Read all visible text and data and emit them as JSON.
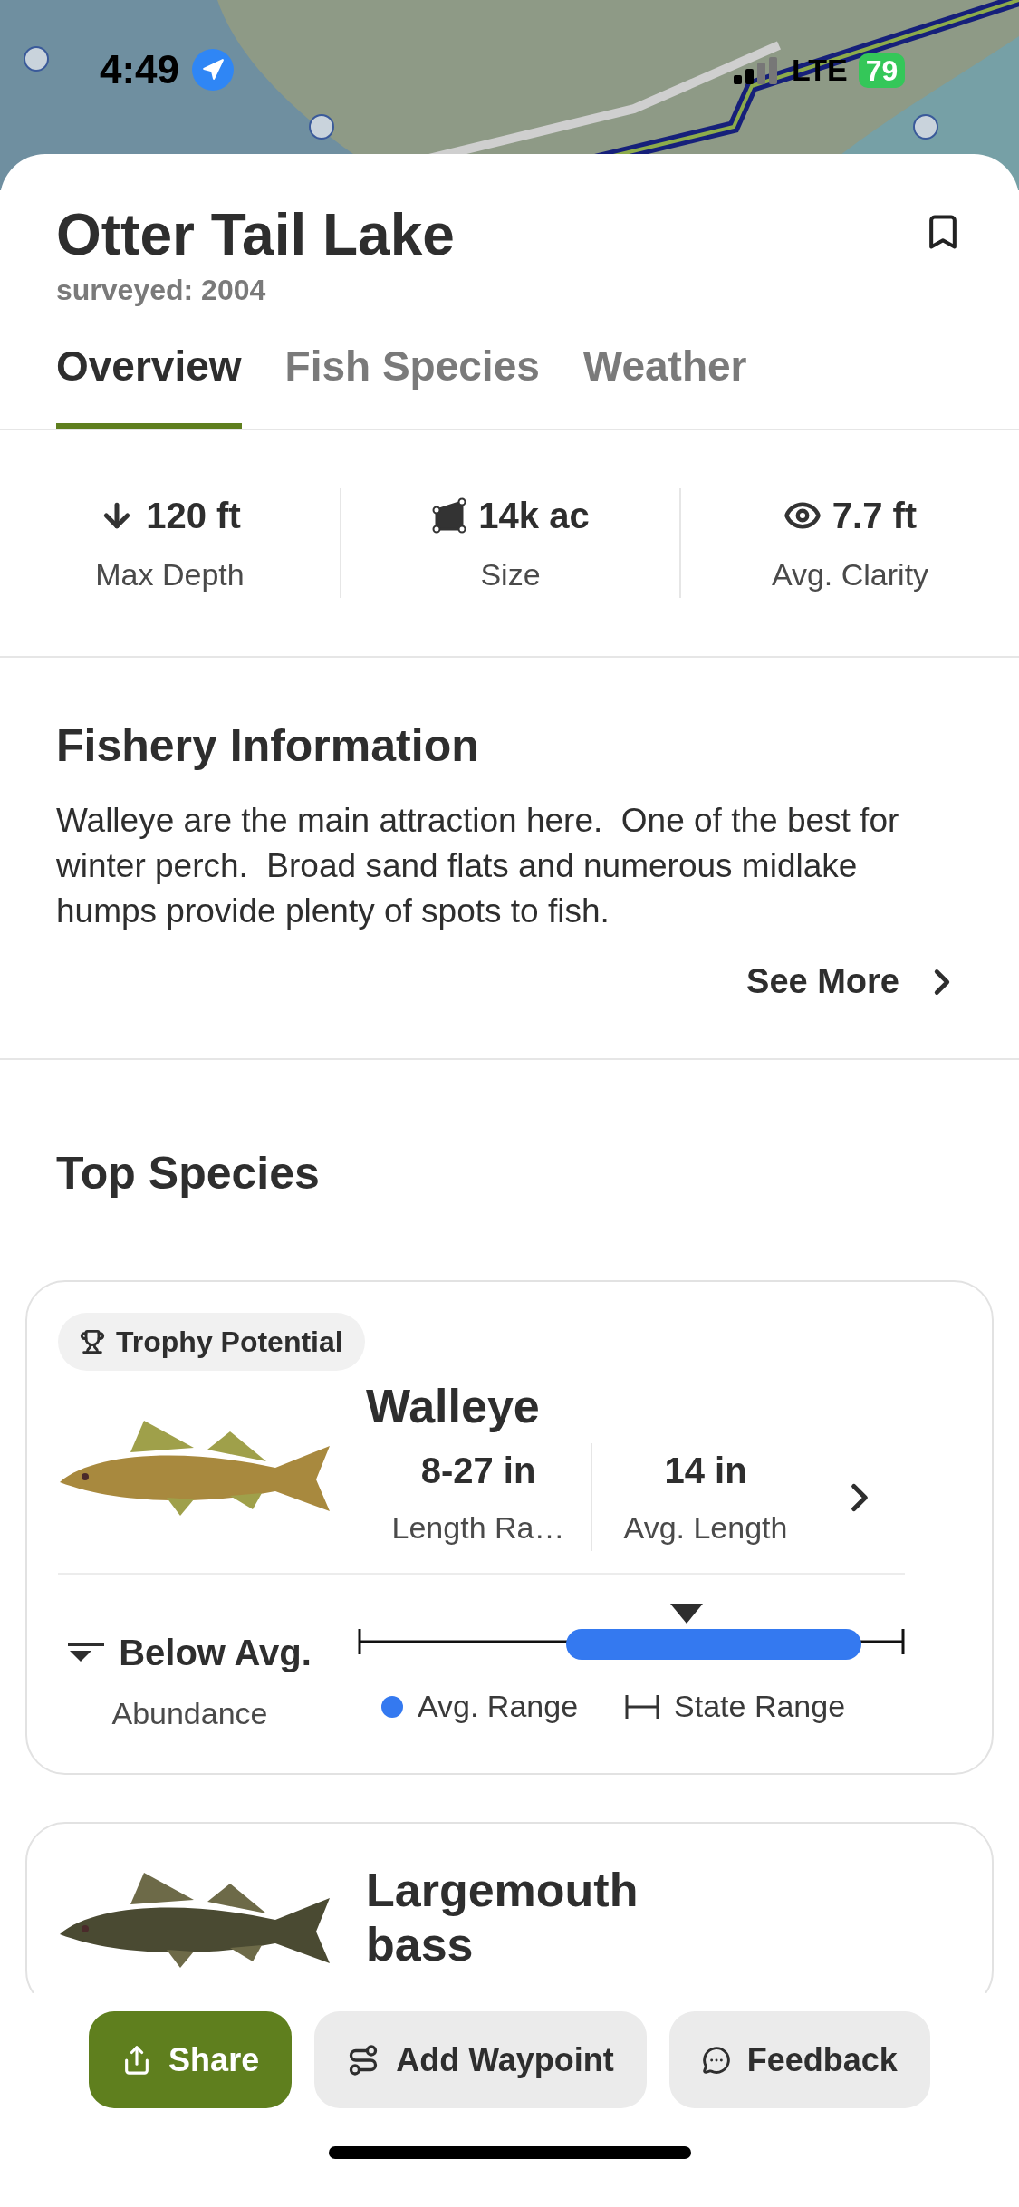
{
  "status_bar": {
    "time": "4:49",
    "network": "LTE",
    "battery": "79"
  },
  "lake": {
    "name": "Otter Tail Lake",
    "surveyed": "surveyed: 2004"
  },
  "tabs": [
    {
      "label": "Overview",
      "selected": true
    },
    {
      "label": "Fish Species",
      "selected": false
    },
    {
      "label": "Weather",
      "selected": false
    }
  ],
  "stats": [
    {
      "kind": "depth",
      "value": "120 ft",
      "label": "Max Depth"
    },
    {
      "kind": "size",
      "value": "14k ac",
      "label": "Size"
    },
    {
      "kind": "clarity",
      "value": "7.7 ft",
      "label": "Avg. Clarity"
    }
  ],
  "fishery": {
    "title": "Fishery Information",
    "text": "Walleye are the main attraction here.  One of the best for winter perch.  Broad sand flats and numerous midlake humps provide plenty of spots to fish.",
    "see_more": "See More"
  },
  "top_species": {
    "title": "Top Species",
    "species": [
      {
        "kind": "full",
        "badge": "Trophy Potential",
        "name": "Walleye",
        "length_range": "8-27 in",
        "length_range_label": "Length Ra…",
        "avg_length": "14 in",
        "avg_length_label": "Avg. Length",
        "abundance": "Below Avg.",
        "abundance_label": "Abundance",
        "legend_avg": "Avg. Range",
        "legend_state": "State Range"
      },
      {
        "kind": "partial",
        "name": "Largemouth bass"
      }
    ]
  },
  "actions": [
    {
      "kind": "share",
      "label": "Share"
    },
    {
      "kind": "waypoint",
      "label": "Add Waypoint"
    },
    {
      "kind": "feedback",
      "label": "Feedback"
    }
  ]
}
